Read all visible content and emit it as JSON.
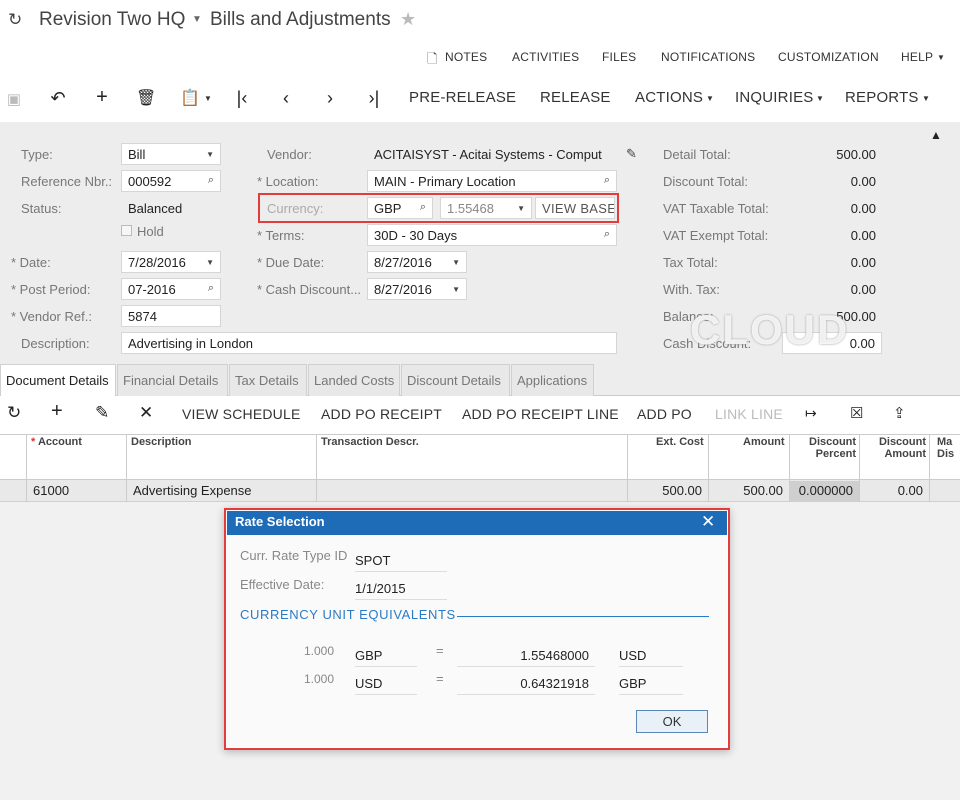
{
  "title": {
    "company": "Revision Two HQ",
    "screen": "Bills and Adjustments"
  },
  "toplinks": [
    "NOTES",
    "ACTIVITIES",
    "FILES",
    "NOTIFICATIONS",
    "CUSTOMIZATION",
    "HELP"
  ],
  "toolbar": {
    "pre_release": "PRE-RELEASE",
    "release": "RELEASE",
    "actions": "ACTIONS",
    "inquiries": "INQUIRIES",
    "reports": "REPORTS"
  },
  "form": {
    "type_label": "Type:",
    "type_value": "Bill",
    "refnbr_label": "Reference Nbr.:",
    "refnbr_value": "000592",
    "status_label": "Status:",
    "status_value": "Balanced",
    "hold_label": "Hold",
    "date_label": "Date:",
    "date_value": "7/28/2016",
    "period_label": "Post Period:",
    "period_value": "07-2016",
    "vendorref_label": "Vendor Ref.:",
    "vendorref_value": "5874",
    "desc_label": "Description:",
    "desc_value": "Advertising in London",
    "vendor_label": "Vendor:",
    "vendor_value": "ACITAISYST - Acitai Systems - Comput",
    "location_label": "Location:",
    "location_value": "MAIN - Primary Location",
    "currency_label": "Currency:",
    "currency_value": "GBP",
    "rate_value": "1.55468",
    "view_base": "VIEW BASE",
    "terms_label": "Terms:",
    "terms_value": "30D - 30 Days",
    "duedate_label": "Due Date:",
    "duedate_value": "8/27/2016",
    "cashdisc_label": "Cash Discount...",
    "cashdisc_value": "8/27/2016"
  },
  "totals": [
    {
      "label": "Detail Total:",
      "value": "500.00"
    },
    {
      "label": "Discount Total:",
      "value": "0.00"
    },
    {
      "label": "VAT Taxable Total:",
      "value": "0.00"
    },
    {
      "label": "VAT Exempt Total:",
      "value": "0.00"
    },
    {
      "label": "Tax Total:",
      "value": "0.00"
    },
    {
      "label": "With. Tax:",
      "value": "0.00"
    },
    {
      "label": "Balance:",
      "value": "500.00"
    },
    {
      "label": "Cash Discount:",
      "value": "0.00"
    }
  ],
  "tabs": [
    "Document Details",
    "Financial Details",
    "Tax Details",
    "Landed Costs",
    "Discount Details",
    "Applications"
  ],
  "grid_toolbar": {
    "view_schedule": "VIEW SCHEDULE",
    "add_po_receipt": "ADD PO RECEIPT",
    "add_po_receipt_line": "ADD PO RECEIPT LINE",
    "add_po": "ADD PO",
    "link_line": "LINK LINE"
  },
  "grid": {
    "headers": {
      "account": "Account",
      "description": "Description",
      "trans_descr": "Transaction Descr.",
      "ext_cost": "Ext. Cost",
      "amount": "Amount",
      "disc_percent_1": "Discount",
      "disc_percent_2": "Percent",
      "disc_amount_1": "Discount",
      "disc_amount_2": "Amount",
      "more_1": "Ma",
      "more_2": "Dis"
    },
    "row": {
      "account": "61000",
      "description": "Advertising Expense",
      "ext_cost": "500.00",
      "amount": "500.00",
      "disc_percent": "0.000000",
      "disc_amount": "0.00"
    }
  },
  "dialog": {
    "title": "Rate Selection",
    "rate_type_label": "Curr. Rate Type ID",
    "rate_type_value": "SPOT",
    "eff_date_label": "Effective Date:",
    "eff_date_value": "1/1/2015",
    "section": "CURRENCY UNIT EQUIVALENTS",
    "rows": [
      {
        "qty": "1.000",
        "from": "GBP",
        "eq": "=",
        "rate": "1.55468000",
        "to": "USD"
      },
      {
        "qty": "1.000",
        "from": "USD",
        "eq": "=",
        "rate": "0.64321918",
        "to": "GBP"
      }
    ],
    "ok": "OK"
  },
  "watermark": "CLOUD"
}
